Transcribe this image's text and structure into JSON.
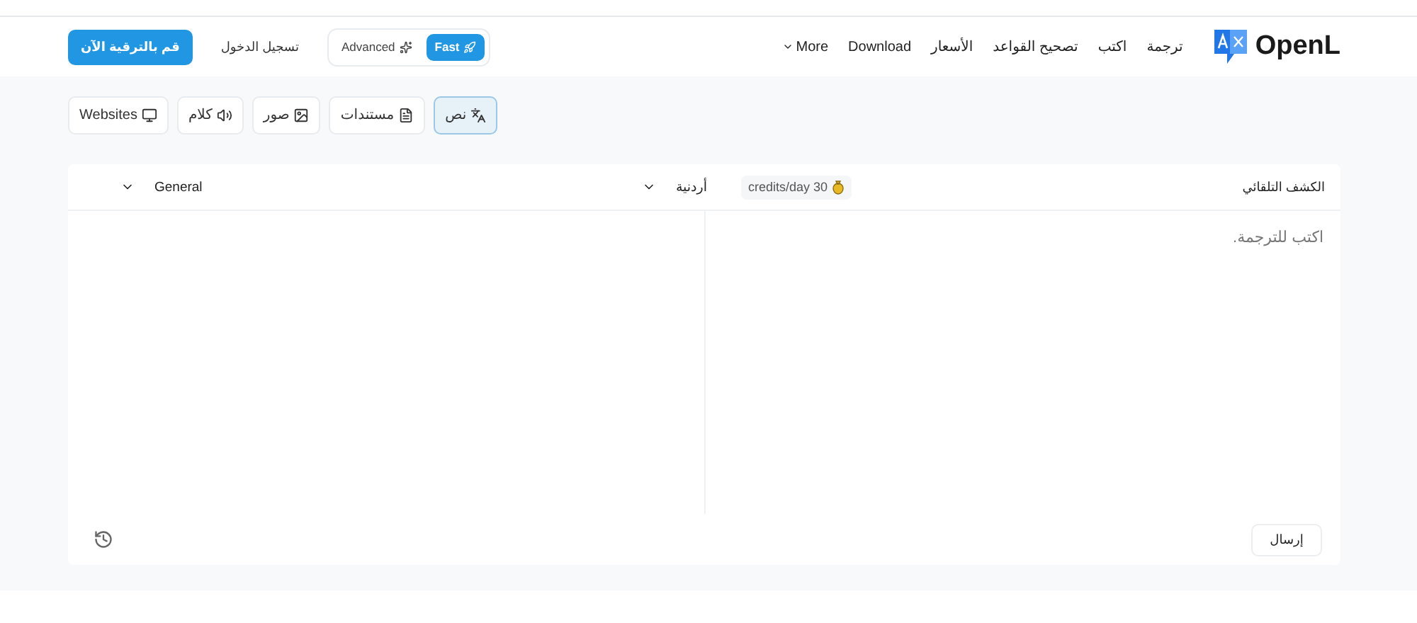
{
  "header": {
    "logo": "OpenL",
    "nav": [
      {
        "label": "ترجمة",
        "kind": "link"
      },
      {
        "label": "اكتب",
        "kind": "link"
      },
      {
        "label": "تصحيح القواعد",
        "kind": "link"
      },
      {
        "label": "الأسعار",
        "kind": "link"
      },
      {
        "label": "Download",
        "kind": "link"
      },
      {
        "label": "More",
        "kind": "menu"
      }
    ],
    "modes": [
      {
        "label": "Fast",
        "selected": true
      },
      {
        "label": "Advanced",
        "selected": false
      }
    ],
    "login": "تسجيل الدخول",
    "upgrade": "قم بالترقية الآن"
  },
  "tabs": [
    {
      "label": "نص",
      "selected": true
    },
    {
      "label": "مستندات",
      "selected": false
    },
    {
      "label": "صور",
      "selected": false
    },
    {
      "label": "كلام",
      "selected": false
    },
    {
      "label": "Websites",
      "selected": false
    }
  ],
  "translator": {
    "source_language": "الكشف التلقائي",
    "credits": "credits/day 30",
    "target_language": "أردنية",
    "style": "General",
    "placeholder": "اكتب للترجمة.",
    "send": "إرسال"
  }
}
